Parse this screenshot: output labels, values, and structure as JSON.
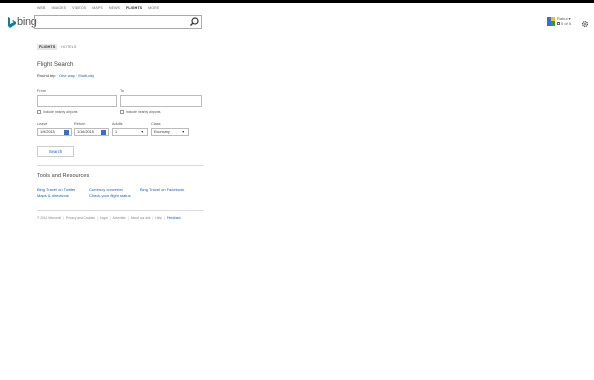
{
  "nav": {
    "items": [
      "WEB",
      "IMAGES",
      "VIDEOS",
      "MAPS",
      "NEWS",
      "FLIGHTS",
      "MORE"
    ],
    "active": "FLIGHTS"
  },
  "logo": {
    "text": "bing"
  },
  "search": {
    "value": "",
    "placeholder": ""
  },
  "user": {
    "name": "Rahul ▾",
    "rewards": "0 of 5"
  },
  "tabs": {
    "flights": "FLIGHTS",
    "hotels": "HOTELS"
  },
  "flight": {
    "heading": "Flight Search",
    "trip_round": "Round trip",
    "trip_sep1": " · ",
    "trip_oneway": "One way",
    "trip_sep2": " · ",
    "trip_multi": "Multi-city",
    "from_label": "From",
    "to_label": "To",
    "from_value": "",
    "to_value": "",
    "nearby_from": "Include nearby airports",
    "nearby_to": "Include nearby airports",
    "leave_label": "Leave",
    "return_label": "Return",
    "adults_label": "Adults",
    "class_label": "Class",
    "leave_value": "1/9/2015",
    "return_value": "1/16/2015",
    "adults_value": "1",
    "class_value": "Economy",
    "search_button": "Search"
  },
  "tools": {
    "title": "Tools and Resources",
    "twitter": "Bing Travel on Twitter",
    "currency": "Currency converter",
    "facebook": "Bing Travel on Facebook",
    "maps": "Maps & directions",
    "status": "Check your flight status"
  },
  "footer": {
    "copyright": "© 2014 Microsoft",
    "privacy": "Privacy and Cookies",
    "legal": "Legal",
    "advertise": "Advertise",
    "about": "About our ads",
    "help": "Help",
    "feedback": "Feedback",
    "sep": "|"
  },
  "colors": {
    "link": "#1a5fb4",
    "accent": "#3a6fd1"
  }
}
